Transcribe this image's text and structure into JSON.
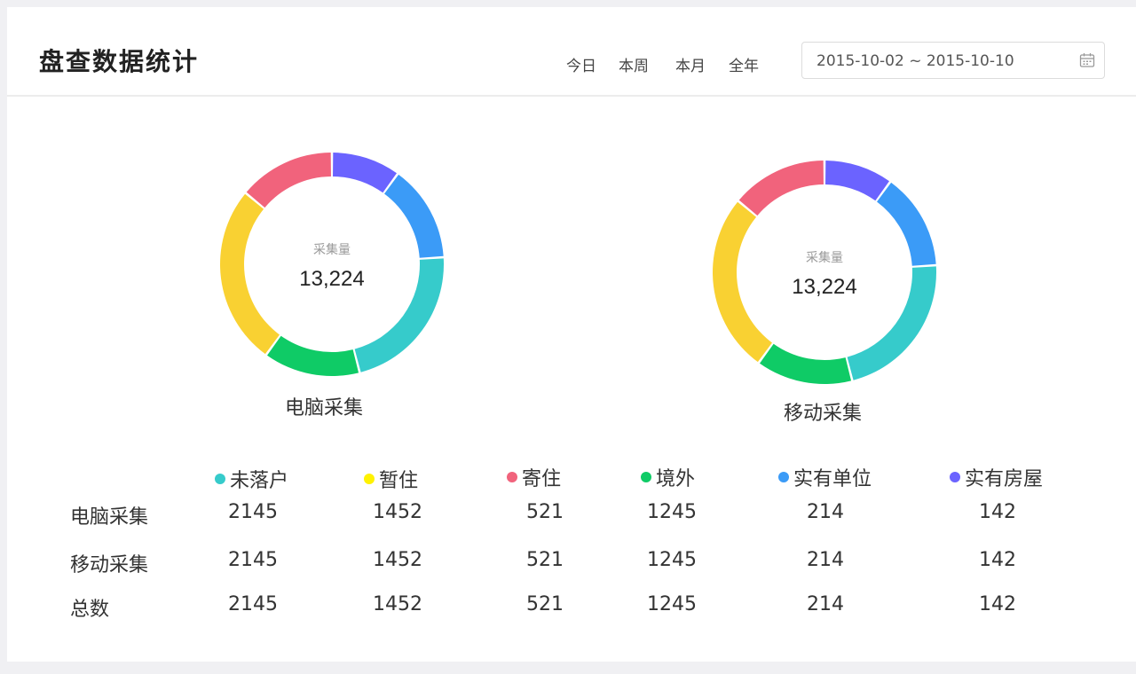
{
  "header": {
    "title": "盘查数据统计",
    "tabs": [
      "今日",
      "本周",
      "本月",
      "全年"
    ],
    "date_range": "2015-10-02 ~ 2015-10-10"
  },
  "chart_data": [
    {
      "type": "pie",
      "title": "电脑采集",
      "center_label": "采集量",
      "center_value": "13,224",
      "categories": [
        "实有房屋",
        "实有单位",
        "未落户",
        "境外",
        "暂住",
        "寄住"
      ],
      "values": [
        10,
        14,
        22,
        14,
        26,
        14
      ],
      "colors": [
        "#6b63ff",
        "#3b9bf7",
        "#36cbcb",
        "#0fcb66",
        "#f9d132",
        "#f1637c"
      ]
    },
    {
      "type": "pie",
      "title": "移动采集",
      "center_label": "采集量",
      "center_value": "13,224",
      "categories": [
        "实有房屋",
        "实有单位",
        "未落户",
        "境外",
        "暂住",
        "寄住"
      ],
      "values": [
        10,
        14,
        22,
        14,
        26,
        14
      ],
      "colors": [
        "#6b63ff",
        "#3b9bf7",
        "#36cbcb",
        "#0fcb66",
        "#f9d132",
        "#f1637c"
      ]
    }
  ],
  "legend": [
    {
      "label": "未落户",
      "color": "#36cbcb"
    },
    {
      "label": "暂住",
      "color": "#fff200"
    },
    {
      "label": "寄住",
      "color": "#f1637c"
    },
    {
      "label": "境外",
      "color": "#0fcb66"
    },
    {
      "label": "实有单位",
      "color": "#3b9bf7"
    },
    {
      "label": "实有房屋",
      "color": "#6b63ff"
    }
  ],
  "table": {
    "rows": [
      {
        "label": "电脑采集",
        "values": [
          "2145",
          "1452",
          "521",
          "1245",
          "214",
          "142"
        ]
      },
      {
        "label": "移动采集",
        "values": [
          "2145",
          "1452",
          "521",
          "1245",
          "214",
          "142"
        ]
      },
      {
        "label": "总数",
        "values": [
          "2145",
          "1452",
          "521",
          "1245",
          "214",
          "142"
        ]
      }
    ]
  }
}
